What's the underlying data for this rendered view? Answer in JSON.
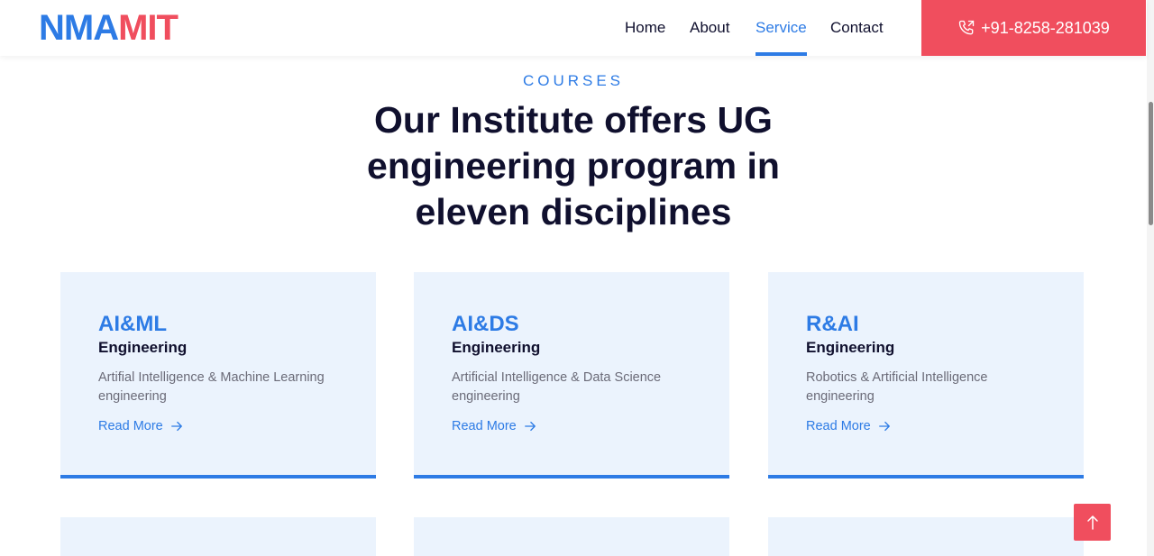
{
  "header": {
    "logo_part1": "NMA",
    "logo_part2": "MIT",
    "nav": [
      "Home",
      "About",
      "Service",
      "Contact"
    ],
    "active_nav": "Service",
    "phone": "+91-8258-281039"
  },
  "courses": {
    "eyebrow": "COURSES",
    "headline": "Our Institute offers UG engineering program in eleven disciplines",
    "cards": [
      {
        "title": "AI&ML",
        "subtitle": "Engineering",
        "description": "Artifial Intelligence & Machine Learning engineering",
        "link": "Read More"
      },
      {
        "title": "AI&DS",
        "subtitle": "Engineering",
        "description": "Artificial Intelligence & Data Science engineering",
        "link": "Read More"
      },
      {
        "title": "R&AI",
        "subtitle": "Engineering",
        "description": "Robotics & Artificial Intelligence engineering",
        "link": "Read More"
      }
    ]
  },
  "colors": {
    "accent_blue": "#2d7be5",
    "accent_red": "#f04e5e",
    "card_background": "#ebf3fd",
    "heading_dark": "#10102e"
  },
  "icons": {
    "phone": "phone-icon",
    "read_more": "arrow-right-icon",
    "back_to_top": "arrow-up-icon"
  }
}
